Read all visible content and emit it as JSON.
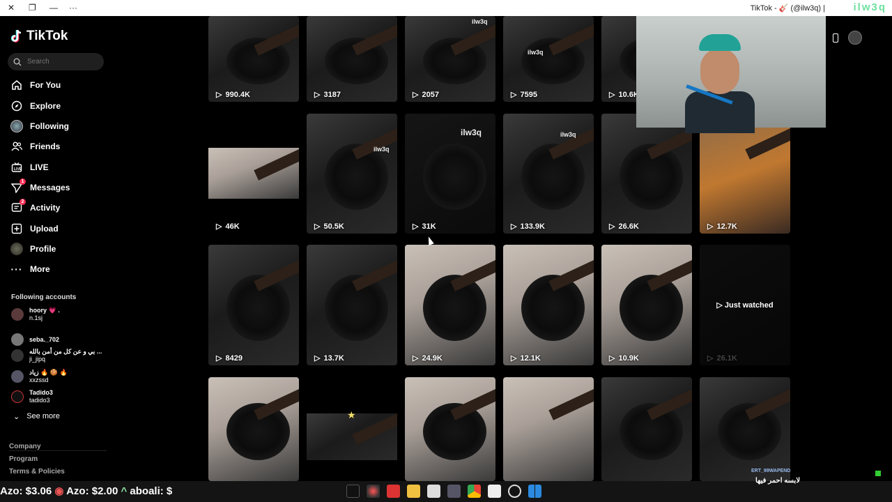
{
  "window": {
    "title": "TikTok - 🎸 (@ilw3q) |",
    "title_extra": "ilw3q"
  },
  "sidebar": {
    "logo_text": "TikTok",
    "search_placeholder": "Search",
    "nav": [
      {
        "label": "For You",
        "icon": "home-icon"
      },
      {
        "label": "Explore",
        "icon": "compass-icon"
      },
      {
        "label": "Following",
        "icon": "following-avatar-icon"
      },
      {
        "label": "Friends",
        "icon": "friends-icon"
      },
      {
        "label": "LIVE",
        "icon": "live-icon"
      },
      {
        "label": "Messages",
        "icon": "messages-icon",
        "badge": "1"
      },
      {
        "label": "Activity",
        "icon": "activity-icon",
        "badge": "2"
      },
      {
        "label": "Upload",
        "icon": "upload-icon"
      },
      {
        "label": "Profile",
        "icon": "profile-avatar-icon"
      },
      {
        "label": "More",
        "icon": "more-icon"
      }
    ],
    "following_title": "Following accounts",
    "accounts": [
      {
        "name": "hoory 💗 .",
        "handle": "n.1sj"
      },
      {
        "name": "seba._702",
        "handle": ""
      },
      {
        "name": "بي و عن كل من أمن بالله ...",
        "handle": "ji_jipq"
      },
      {
        "name": "زياد 🔥 🍪 🔥",
        "handle": "xxzssd"
      },
      {
        "name": "Tadido3",
        "handle": "tadido3"
      }
    ],
    "see_more": "See more",
    "footer": [
      "Company",
      "Program",
      "Terms & Policies"
    ]
  },
  "grid": {
    "rows": [
      [
        "990.4K",
        "3187",
        "2057",
        "7595",
        "10.6K",
        ""
      ],
      [
        "46K",
        "50.5K",
        "31K",
        "133.9K",
        "26.6K",
        "12.7K"
      ],
      [
        "8429",
        "13.7K",
        "24.9K",
        "12.1K",
        "10.9K",
        "26.1K"
      ],
      [
        "",
        "",
        "",
        "",
        "",
        ""
      ]
    ],
    "just_watched": "Just watched",
    "watermark": "ilw3q"
  },
  "taskbar": {
    "ticker_1": "Azo: $3.06",
    "ticker_2": "Azo: $2.00",
    "ticker_3": "aboali: $"
  },
  "chat": {
    "user": "ERT_99WAPEND",
    "message": "لابسه احمر فيها"
  }
}
